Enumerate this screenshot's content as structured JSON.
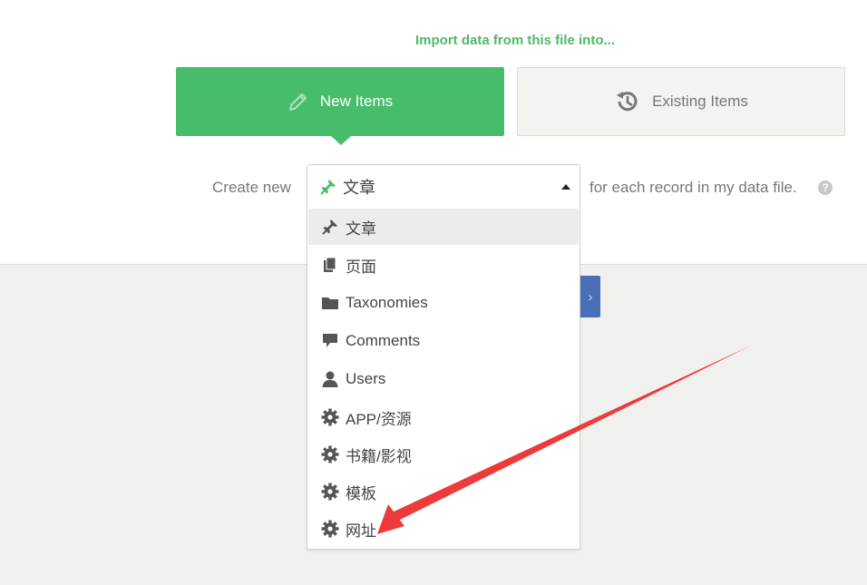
{
  "import": {
    "heading": "Import data from this file into...",
    "new_items_label": "New Items",
    "existing_items_label": "Existing Items"
  },
  "create": {
    "prefix": "Create new",
    "suffix": "for each record in my data file.",
    "help": "?",
    "selected": "文章"
  },
  "dropdown": {
    "items": [
      {
        "label": "文章",
        "icon": "pin-icon"
      },
      {
        "label": "页面",
        "icon": "pages-icon"
      },
      {
        "label": "Taxonomies",
        "icon": "folder-icon"
      },
      {
        "label": "Comments",
        "icon": "comment-icon"
      },
      {
        "label": "Users",
        "icon": "user-icon"
      },
      {
        "label": "APP/资源",
        "icon": "gear-icon"
      },
      {
        "label": "书籍/影视",
        "icon": "gear-icon"
      },
      {
        "label": "模板",
        "icon": "gear-icon"
      },
      {
        "label": "网址",
        "icon": "gear-icon"
      }
    ]
  },
  "colors": {
    "accent_green": "#47bd6c",
    "heading_green": "#4fb86a",
    "annotation_red": "#ee3a3a",
    "next_button_blue": "#4a6fb7"
  }
}
